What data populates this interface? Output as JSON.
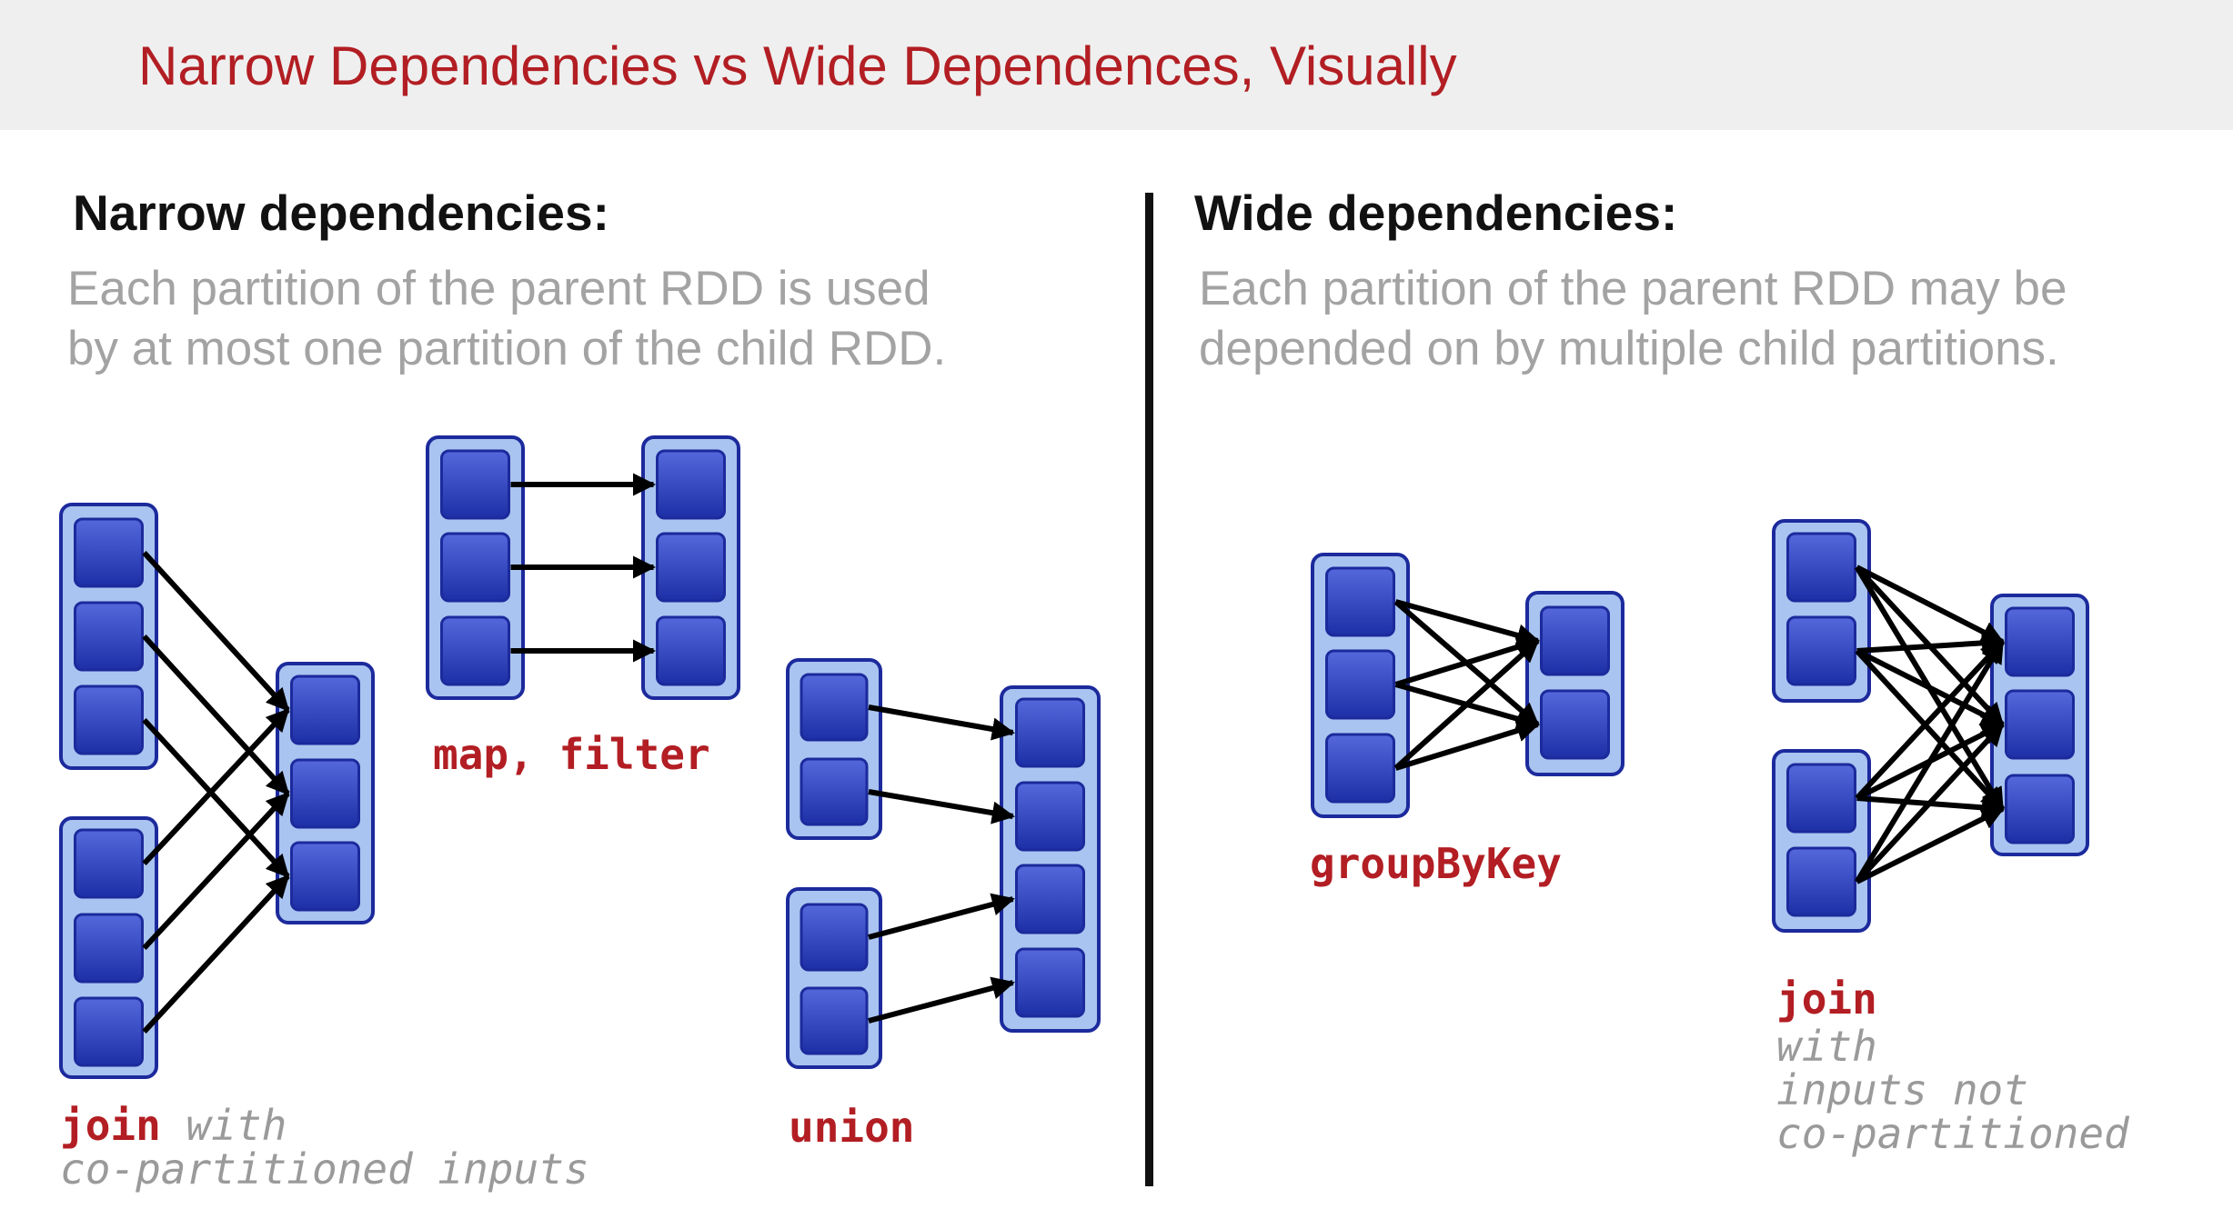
{
  "slide": {
    "title": "Narrow Dependencies vs Wide Dependences, Visually"
  },
  "narrow": {
    "heading": "Narrow dependencies:",
    "desc_line1": "Each partition of the parent RDD is used",
    "desc_line2": "by at most one partition of the child RDD.",
    "examples": {
      "map_filter": "map, filter",
      "join_kw": "join",
      "join_note1": "with",
      "join_note2": "co-partitioned inputs",
      "union": "union"
    }
  },
  "wide": {
    "heading": "Wide dependencies:",
    "desc_line1": "Each partition of the parent RDD may be",
    "desc_line2": "depended on by multiple child partitions.",
    "examples": {
      "groupbykey": "groupByKey",
      "join_kw": "join",
      "join_note1": "with",
      "join_note2": "inputs not",
      "join_note3": "co-partitioned"
    }
  },
  "colors": {
    "title": "#b21e23",
    "rdd_fill": "#a9c4f0",
    "rdd_border": "#1c2a9c",
    "partition": "#2b3fbf",
    "arrow": "#000000"
  }
}
